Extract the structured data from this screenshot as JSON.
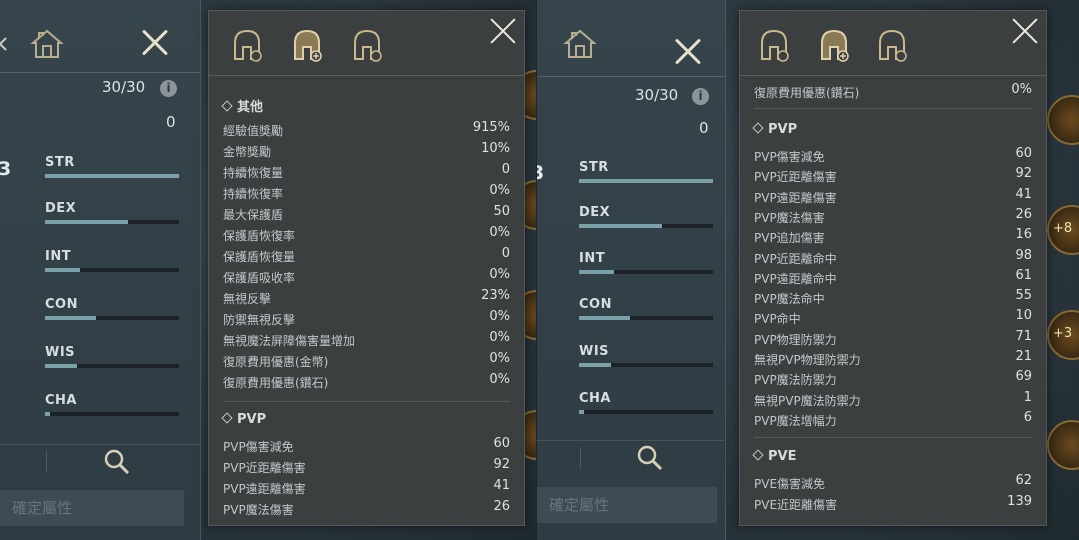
{
  "left": {
    "points": "30/30",
    "zero_value": "0",
    "big_digit": "3",
    "stats": [
      {
        "label": "STR",
        "level": 1.0
      },
      {
        "label": "DEX",
        "level": 0.62
      },
      {
        "label": "INT",
        "level": 0.26
      },
      {
        "label": "CON",
        "level": 0.38
      },
      {
        "label": "WIS",
        "level": 0.24
      },
      {
        "label": "CHA",
        "level": 0.04
      }
    ],
    "confirm_label": "確定屬性",
    "detail": {
      "other_title": "其他",
      "other_rows": [
        {
          "k": "經驗值獎勵",
          "v": "915%"
        },
        {
          "k": "金幣獎勵",
          "v": "10%"
        },
        {
          "k": "持續恢復量",
          "v": "0"
        },
        {
          "k": "持續恢復率",
          "v": "0%"
        },
        {
          "k": "最大保護盾",
          "v": "50"
        },
        {
          "k": "保護盾恢復率",
          "v": "0%"
        },
        {
          "k": "保護盾恢復量",
          "v": "0"
        },
        {
          "k": "保護盾吸收率",
          "v": "0%"
        },
        {
          "k": "無視反擊",
          "v": "23%"
        },
        {
          "k": "防禦無視反擊",
          "v": "0%"
        },
        {
          "k": "無視魔法屏障傷害量增加",
          "v": "0%"
        },
        {
          "k": "復原費用優惠(金幣)",
          "v": "0%"
        },
        {
          "k": "復原費用優惠(鑽石)",
          "v": "0%"
        }
      ],
      "pvp_title": "PVP",
      "pvp_rows": [
        {
          "k": "PVP傷害減免",
          "v": "60"
        },
        {
          "k": "PVP近距離傷害",
          "v": "92"
        },
        {
          "k": "PVP遠距離傷害",
          "v": "41"
        },
        {
          "k": "PVP魔法傷害",
          "v": "26"
        }
      ]
    }
  },
  "right": {
    "points": "30/30",
    "zero_value": "0",
    "big_digit": "3",
    "stats": [
      {
        "label": "STR",
        "level": 1.0
      },
      {
        "label": "DEX",
        "level": 0.62
      },
      {
        "label": "INT",
        "level": 0.26
      },
      {
        "label": "CON",
        "level": 0.38
      },
      {
        "label": "WIS",
        "level": 0.24
      },
      {
        "label": "CHA",
        "level": 0.04
      }
    ],
    "confirm_label": "確定屬性",
    "detail": {
      "top_row": {
        "k": "復原費用優惠(鑽石)",
        "v": "0%"
      },
      "pvp_title": "PVP",
      "pvp_rows": [
        {
          "k": "PVP傷害減免",
          "v": "60"
        },
        {
          "k": "PVP近距離傷害",
          "v": "92"
        },
        {
          "k": "PVP遠距離傷害",
          "v": "41"
        },
        {
          "k": "PVP魔法傷害",
          "v": "26"
        },
        {
          "k": "PVP追加傷害",
          "v": "16"
        },
        {
          "k": "PVP近距離命中",
          "v": "98"
        },
        {
          "k": "PVP遠距離命中",
          "v": "61"
        },
        {
          "k": "PVP魔法命中",
          "v": "55"
        },
        {
          "k": "PVP命中",
          "v": "10"
        },
        {
          "k": "PVP物理防禦力",
          "v": "71"
        },
        {
          "k": "無視PVP物理防禦力",
          "v": "21"
        },
        {
          "k": "PVP魔法防禦力",
          "v": "69"
        },
        {
          "k": "無視PVP魔法防禦力",
          "v": "1"
        },
        {
          "k": "PVP魔法增幅力",
          "v": "6"
        }
      ],
      "pve_title": "PVE",
      "pve_rows": [
        {
          "k": "PVE傷害減免",
          "v": "62"
        },
        {
          "k": "PVE近距離傷害",
          "v": "139"
        }
      ]
    },
    "orb_labels": [
      "+8",
      "+3"
    ]
  },
  "colors": {
    "bar_fill": "#7aa0a8",
    "panel": "#3c3f40",
    "stat_panel": "#33414a"
  }
}
